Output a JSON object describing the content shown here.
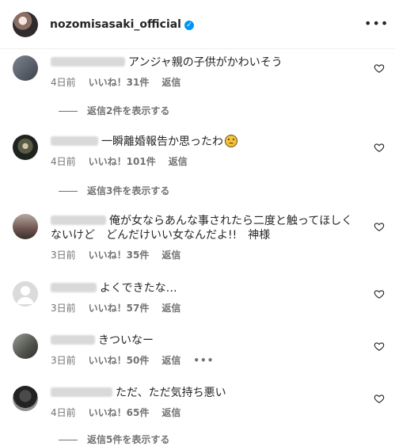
{
  "header": {
    "username": "nozomisasaki_official",
    "verified_symbol": "✓",
    "more_symbol": "•••"
  },
  "comments": [
    {
      "text": "アンジャ親の子供がかわいそう",
      "time": "4日前",
      "likes": "いいね！31件",
      "reply": "返信",
      "view_replies": "返信2件を表示する"
    },
    {
      "text": "一瞬離婚報告か思ったわ",
      "time": "4日前",
      "likes": "いいね！101件",
      "reply": "返信",
      "view_replies": "返信3件を表示する"
    },
    {
      "text": "俺が女ならあんな事されたら二度と触ってほしくないけど　どんだけいい女なんだよ!!　神様",
      "time": "3日前",
      "likes": "いいね！35件",
      "reply": "返信"
    },
    {
      "text": "よくできたな…",
      "time": "3日前",
      "likes": "いいね！57件",
      "reply": "返信"
    },
    {
      "text": "きついなー",
      "time": "3日前",
      "likes": "いいね！50件",
      "reply": "返信",
      "more_symbol": "•••"
    },
    {
      "text": "ただ、ただ気持ち悪い",
      "time": "4日前",
      "likes": "いいね！65件",
      "reply": "返信",
      "view_replies": "返信5件を表示する"
    }
  ],
  "icons": {
    "heart": "heart-outline-icon",
    "more": "more-horizontal-icon",
    "verified": "verified-badge-icon"
  },
  "colors": {
    "accent": "#0095f6",
    "secondary_text": "#737373",
    "primary_text": "#262626"
  }
}
